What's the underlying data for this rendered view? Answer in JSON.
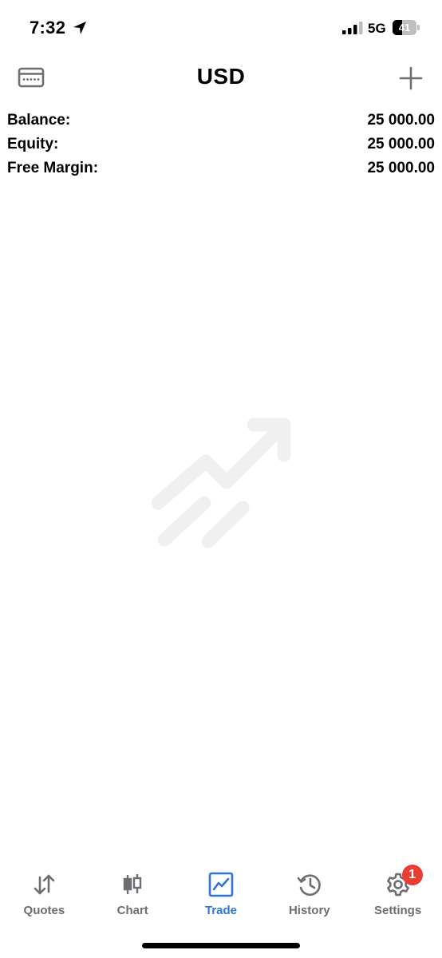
{
  "status_bar": {
    "time": "7:32",
    "network": "5G",
    "battery_percent": "41",
    "battery_level": 0.41
  },
  "header": {
    "title": "USD"
  },
  "account": {
    "rows": [
      {
        "label": "Balance:",
        "value": "25 000.00"
      },
      {
        "label": "Equity:",
        "value": "25 000.00"
      },
      {
        "label": "Free Margin:",
        "value": "25 000.00"
      }
    ]
  },
  "tabs": [
    {
      "label": "Quotes",
      "icon": "quotes-arrows-icon",
      "active": false
    },
    {
      "label": "Chart",
      "icon": "candlestick-icon",
      "active": false
    },
    {
      "label": "Trade",
      "icon": "trade-chart-icon",
      "active": true
    },
    {
      "label": "History",
      "icon": "history-clock-icon",
      "active": false
    },
    {
      "label": "Settings",
      "icon": "gear-icon",
      "active": false,
      "badge": "1"
    }
  ],
  "colors": {
    "active_tab": "#2f74d6",
    "inactive_tab": "#6d6d72",
    "badge": "#ea3d31",
    "illustration": "#f0f0f0"
  }
}
